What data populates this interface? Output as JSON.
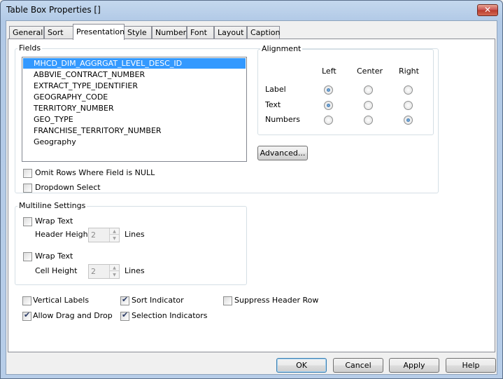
{
  "window": {
    "title": "Table Box Properties []",
    "close_glyph": "✕"
  },
  "tabs": [
    {
      "label": "General"
    },
    {
      "label": "Sort"
    },
    {
      "label": "Presentation"
    },
    {
      "label": "Style"
    },
    {
      "label": "Number"
    },
    {
      "label": "Font"
    },
    {
      "label": "Layout"
    },
    {
      "label": "Caption"
    }
  ],
  "active_tab": "Presentation",
  "fields": {
    "label": "Fields",
    "items": [
      "MHCD_DIM_AGGRGAT_LEVEL_DESC_ID",
      "ABBVIE_CONTRACT_NUMBER",
      "EXTRACT_TYPE_IDENTIFIER",
      "GEOGRAPHY_CODE",
      "TERRITORY_NUMBER",
      "GEO_TYPE",
      "FRANCHISE_TERRITORY_NUMBER",
      "Geography"
    ],
    "selected_index": 0,
    "omit_rows_label": "Omit Rows Where Field is NULL",
    "omit_rows_checked": false,
    "dropdown_select_label": "Dropdown Select",
    "dropdown_select_checked": false
  },
  "alignment": {
    "label": "Alignment",
    "columns": [
      "Left",
      "Center",
      "Right"
    ],
    "rows": [
      {
        "label": "Label",
        "selected": "Left"
      },
      {
        "label": "Text",
        "selected": "Left"
      },
      {
        "label": "Numbers",
        "selected": "Right"
      }
    ]
  },
  "advanced_button": "Advanced...",
  "multiline": {
    "label": "Multiline Settings",
    "wrap_header_label": "Wrap Text",
    "wrap_header_checked": false,
    "header_height_label": "Header Height",
    "header_height_value": "2",
    "header_lines_label": "Lines",
    "wrap_cell_label": "Wrap Text",
    "wrap_cell_checked": false,
    "cell_height_label": "Cell Height",
    "cell_height_value": "2",
    "cell_lines_label": "Lines"
  },
  "options": {
    "vertical_labels": {
      "label": "Vertical Labels",
      "checked": false
    },
    "sort_indicator": {
      "label": "Sort Indicator",
      "checked": true
    },
    "suppress_header_row": {
      "label": "Suppress Header Row",
      "checked": false
    },
    "allow_drag_drop": {
      "label": "Allow Drag and Drop",
      "checked": true
    },
    "selection_indicators": {
      "label": "Selection Indicators",
      "checked": true
    }
  },
  "buttons": {
    "ok": "OK",
    "cancel": "Cancel",
    "apply": "Apply",
    "help": "Help"
  }
}
